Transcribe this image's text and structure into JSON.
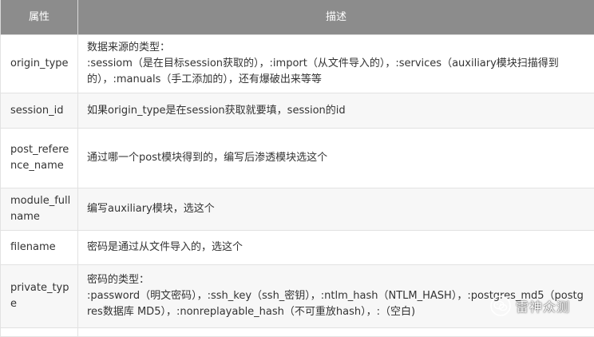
{
  "table": {
    "headers": {
      "attribute": "属性",
      "description": "描述"
    },
    "rows": [
      {
        "name": "origin_type",
        "desc": [
          "数据来源的类型：",
          ":sessiom（是在目标session获取的），:import（从文件导入的），:services（auxiliary模块扫描得到的），:manuals（手工添加的），还有爆破出来等等"
        ]
      },
      {
        "name": "session_id",
        "desc": [
          "如果origin_type是在session获取就要填，session的id"
        ]
      },
      {
        "name": "post_reference_name",
        "desc": [
          "通过哪一个post模块得到的，编写后渗透模块选这个"
        ]
      },
      {
        "name": "module_fullname",
        "desc": [
          "编写auxiliary模块，选这个"
        ]
      },
      {
        "name": "filename",
        "desc": [
          "密码是通过从文件导入的，选这个"
        ]
      },
      {
        "name": "private_type",
        "desc": [
          "密码的类型：",
          ":password（明文密码），:ssh_key（ssh_密钥），:ntlm_hash（NTLM_HASH），:postgres_md5（postgres数据库 MD5），:nonreplayable_hash（不可重放hash），:（空白)"
        ]
      }
    ]
  },
  "watermark": {
    "text": "雷神众测",
    "icon": "wechat-icon"
  }
}
